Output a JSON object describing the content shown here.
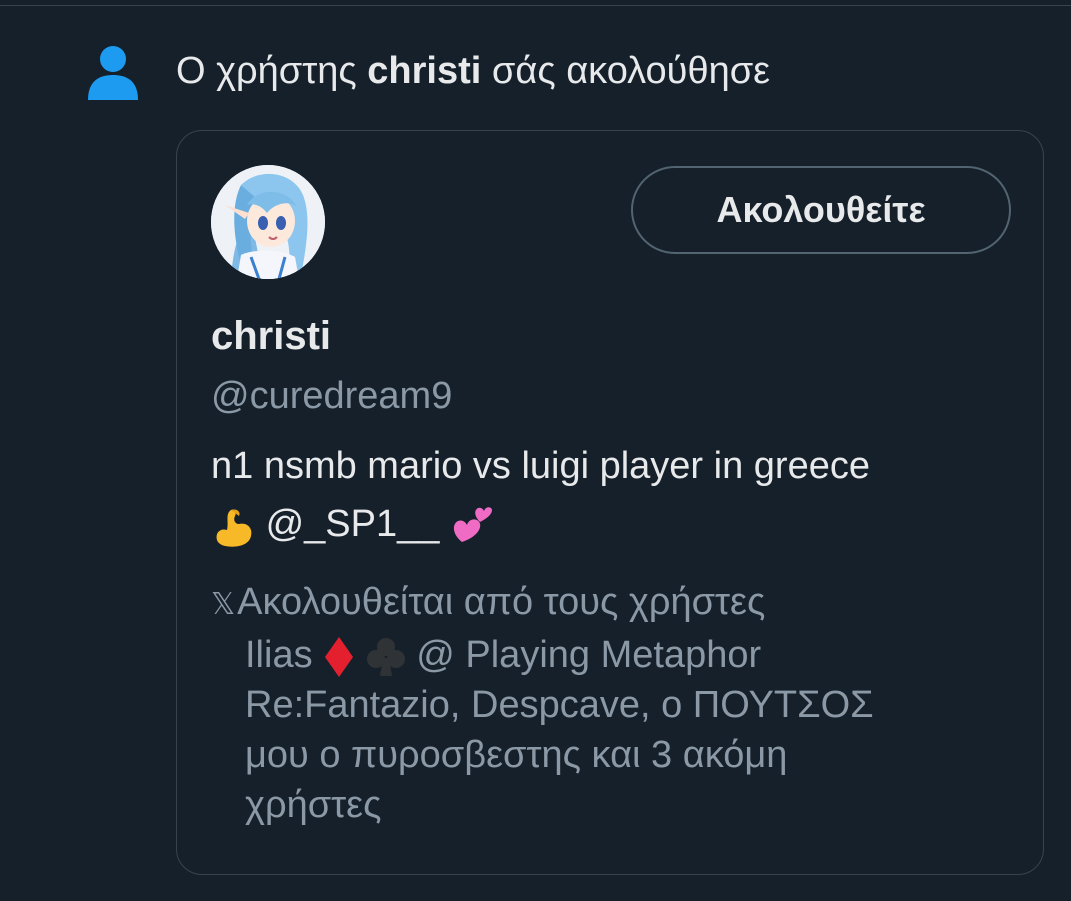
{
  "notification": {
    "icon": "person-icon",
    "icon_color": "#1d9bf0",
    "text_prefix": "Ο χρήστης",
    "username": "christi",
    "text_suffix": "σάς ακολούθησε"
  },
  "card": {
    "avatar": "avatar-image",
    "follow_label": "Ακολουθείτε",
    "display_name": "christi",
    "handle": "@curedream9",
    "bio_line1": "n1 nsmb mario vs luigi player in greece",
    "bio_mention": "@_SP1__",
    "bio_emojis": [
      "flexed-biceps",
      "two-hearts"
    ],
    "followed_by": {
      "icon": "x-logo-icon",
      "line1": "Ακολουθείται από τους χρήστες",
      "line2_name": "Ilias",
      "line2_rest": "@ Playing Metaphor",
      "line2_emojis": [
        "diamond-suit",
        "club-suit"
      ],
      "line3": "Re:Fantazio, Despcave, ο ΠΟΥΤΣΟΣ",
      "line4": "μου ο πυροσβεστης και 3 ακόμη",
      "line5": "χρήστες"
    }
  },
  "colors": {
    "background": "#15202b",
    "border": "#38444d",
    "text": "#e7e9ea",
    "muted": "#8b98a5",
    "accent": "#1d9bf0"
  }
}
